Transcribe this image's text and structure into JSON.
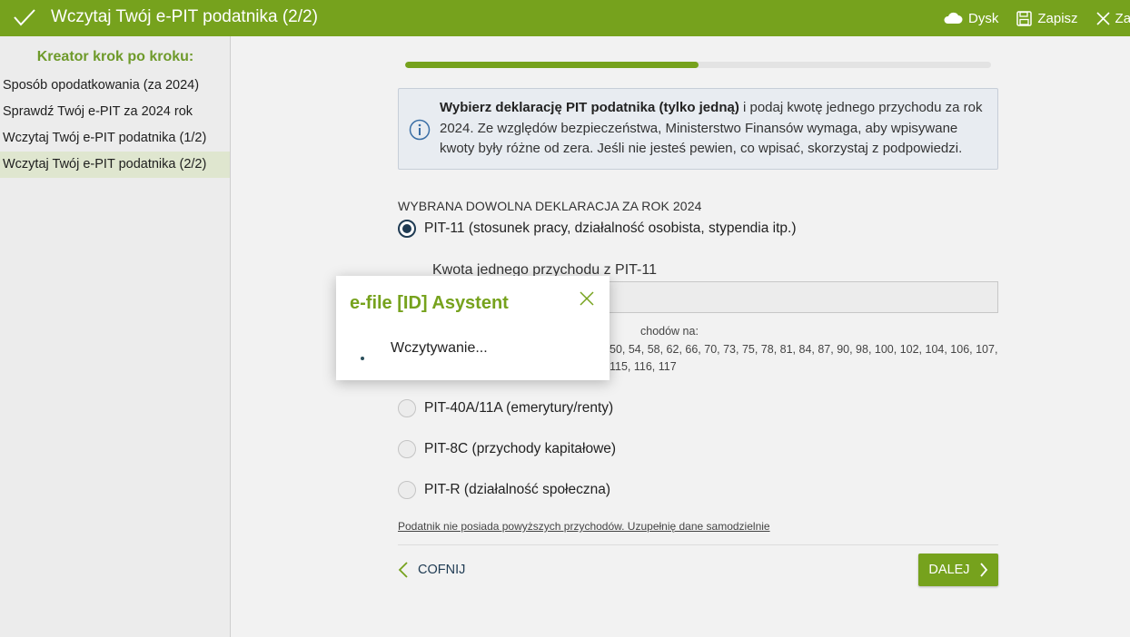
{
  "header": {
    "title": "Wczytaj Twój e-PIT podatnika (2/2)",
    "actions": {
      "drive_label": "Dysk",
      "save_label": "Zapisz",
      "close_label": "Zamknij"
    }
  },
  "sidebar": {
    "title": "Kreator krok po kroku:",
    "items": [
      {
        "label": "Sposób opodatkowania (za 2024)"
      },
      {
        "label": "Sprawdź Twój e-PIT za 2024 rok"
      },
      {
        "label": "Wczytaj Twój e-PIT podatnika (1/2)"
      },
      {
        "label": "Wczytaj Twój e-PIT podatnika (2/2)",
        "active": true
      }
    ]
  },
  "progress": {
    "fraction": 0.5
  },
  "info": {
    "bold_text": "Wybierz deklarację PIT podatnika (tylko jedną)",
    "text": " i podaj kwotę jednego przychodu za rok 2024. Ze względów bezpieczeństwa, Ministerstwo Finansów wymaga, aby wpisywane kwoty były różne od zera. Jeśli nie jesteś pewien, co wpisać, skorzystaj z podpowiedzi."
  },
  "section_label": "WYBRANA DOWOLNA DEKLARACJA ZA ROK 2024",
  "options": [
    {
      "label": "PIT-11 (stosunek pracy, działalność osobista, stypendia itp.)",
      "checked": true
    },
    {
      "label": "PIT-40A/11A (emerytury/renty)",
      "checked": false
    },
    {
      "label": "PIT-8C (przychody kapitałowe)",
      "checked": false
    },
    {
      "label": "PIT-R (działalność społeczna)",
      "checked": false
    }
  ],
  "amount": {
    "label": "Kwota jednego przychodu z PIT-11",
    "value": "",
    "hint_line1": "chodów na:",
    "hint_line2": "50, 54, 58, 62, 66, 70, 73, 75, 78, 81, 84, 87, 90, 98, 100, 102, 104, 106, 107,",
    "hint_line3": "115, 116, 117"
  },
  "no_income_link": "Podatnik nie posiada powyższych przychodów. Uzupełnię dane samodzielnie",
  "nav": {
    "back_label": "COFNIJ",
    "next_label": "DALEJ"
  },
  "modal": {
    "title": "e-file [ID] Asystent",
    "loading_text": "Wczytywanie..."
  },
  "colors": {
    "brand_green": "#76a21d",
    "navy": "#1f3b53"
  }
}
